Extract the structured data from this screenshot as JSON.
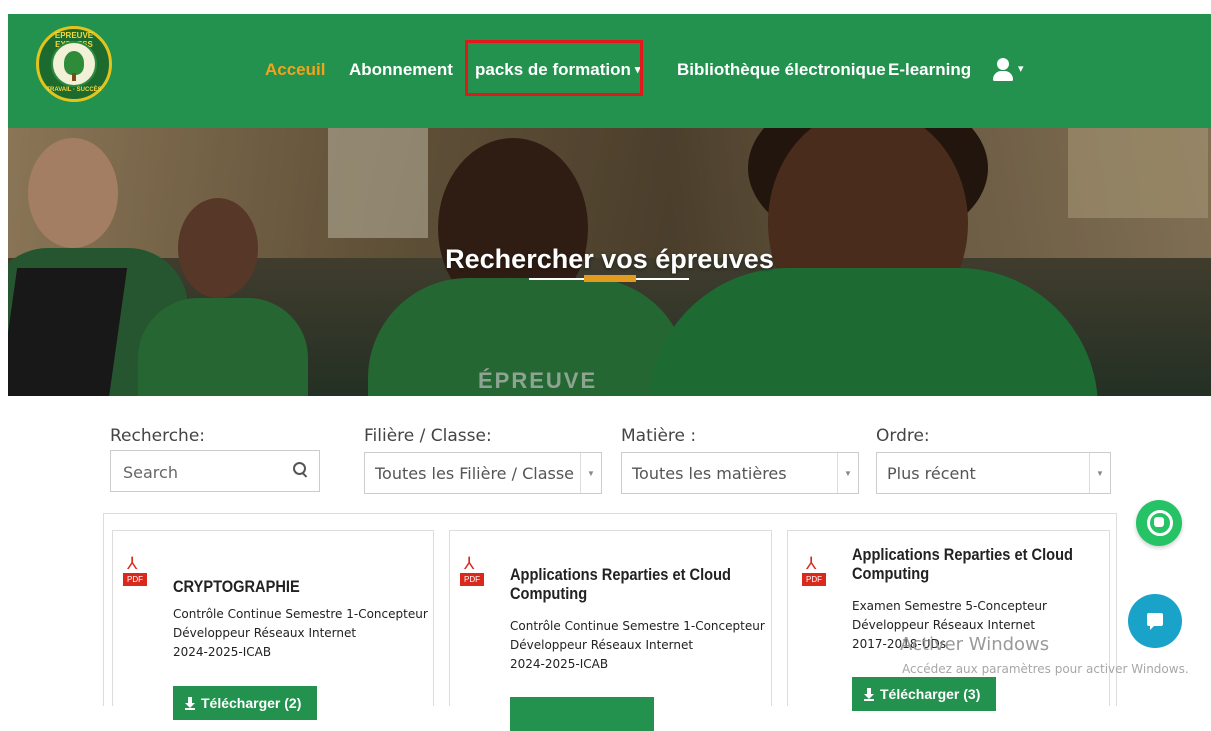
{
  "header": {
    "logo_top_text": "EPREUVE EXPRESS",
    "logo_bottom_text": "TRAVAIL · SUCCÈS",
    "nav": [
      {
        "label": "Acceuil",
        "active": true
      },
      {
        "label": "Abonnement",
        "active": false
      },
      {
        "label": "packs de formation",
        "active": false,
        "dropdown": true
      },
      {
        "label": "Bibliothèque électronique",
        "active": false
      },
      {
        "label": "E-learning",
        "active": false
      }
    ],
    "user_menu_icon": "user-icon",
    "caret_glyph": "▾"
  },
  "hero": {
    "title": "Rechercher vos épreuves",
    "shirt_text": "ÉPREUVE"
  },
  "filters": {
    "search_label": "Recherche:",
    "search_placeholder": "Search",
    "class_label": "Filière / Classe:",
    "class_value": "Toutes les Filière / Classe",
    "subject_label": "Matière :",
    "subject_value": "Toutes les matières",
    "order_label": "Ordre:",
    "order_value": "Plus récent"
  },
  "cards": [
    {
      "title": "CRYPTOGRAPHIE",
      "desc": [
        "Contrôle Continue Semestre 1-Concepteur",
        "Développeur Réseaux Internet",
        "2024-2025-ICAB"
      ],
      "button": "Télécharger (2)"
    },
    {
      "title": "Applications Reparties et Cloud Computing",
      "desc": [
        "Contrôle Continue Semestre 1-Concepteur",
        "Développeur Réseaux Internet",
        "2024-2025-ICAB"
      ],
      "button": ""
    },
    {
      "title": "Applications Reparties et Cloud Computing",
      "desc": [
        "Examen Semestre 5-Concepteur",
        "Développeur Réseaux Internet",
        "2017-2018-UDs"
      ],
      "button": "Télécharger (3)"
    }
  ],
  "pdf_tag": "PDF",
  "windows_watermark": {
    "title": "Activer Windows",
    "subtitle": "Accédez aux paramètres pour activer Windows."
  },
  "colors": {
    "brand_green": "#23924f",
    "accent_orange": "#f0a41d",
    "highlight_red": "#e4171b",
    "whatsapp_green": "#26c266",
    "chat_blue": "#1aa3c9"
  }
}
